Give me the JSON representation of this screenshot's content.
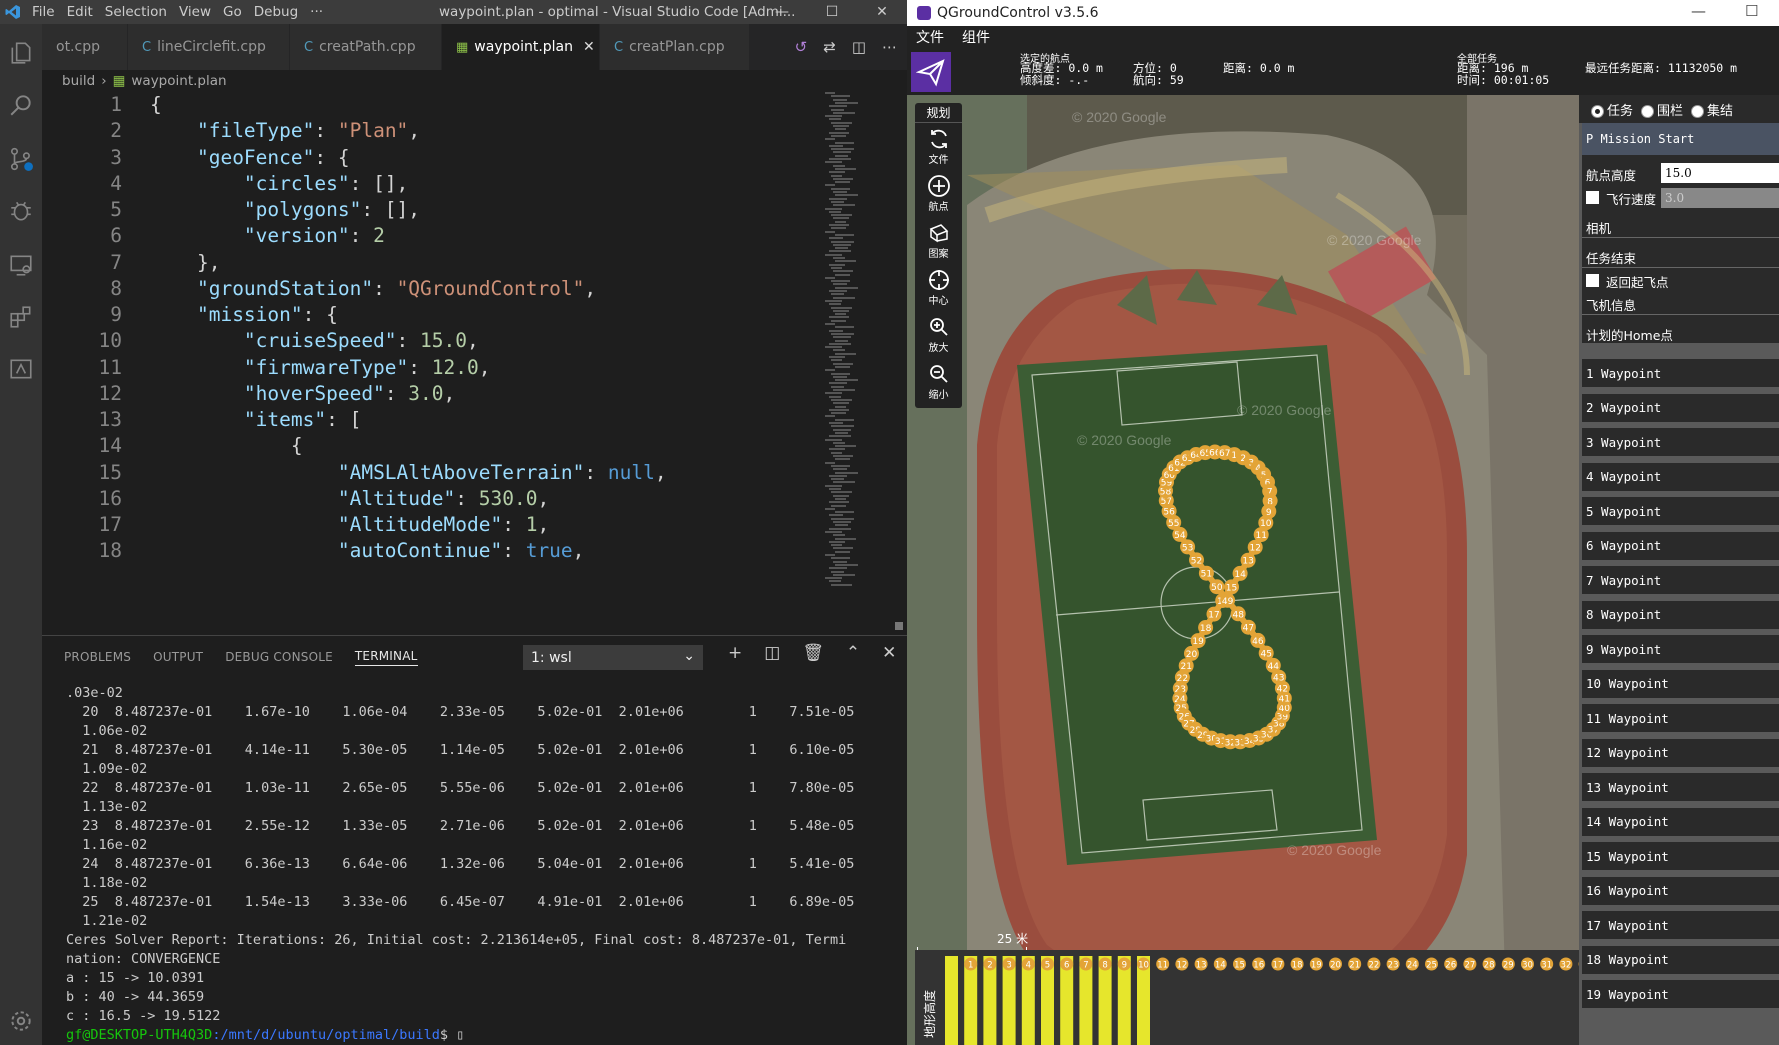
{
  "vscode": {
    "menu": [
      "File",
      "Edit",
      "Selection",
      "View",
      "Go",
      "Debug",
      "···"
    ],
    "window_title": "waypoint.plan - optimal - Visual Studio Code [Admi...",
    "tabs": [
      {
        "label": "ot.cpp",
        "icon": "C",
        "active": false
      },
      {
        "label": "lineCirclefit.cpp",
        "icon": "C",
        "active": false
      },
      {
        "label": "creatPath.cpp",
        "icon": "C",
        "active": false
      },
      {
        "label": "waypoint.plan",
        "icon": "file-icon",
        "active": true
      },
      {
        "label": "creatPlan.cpp",
        "icon": "C",
        "active": false
      }
    ],
    "breadcrumb": [
      "build",
      "waypoint.plan"
    ],
    "code_lines": [
      {
        "n": "1",
        "text": "{"
      },
      {
        "n": "2",
        "text": "    \"fileType\": \"Plan\","
      },
      {
        "n": "3",
        "text": "    \"geoFence\": {"
      },
      {
        "n": "4",
        "text": "        \"circles\": [],"
      },
      {
        "n": "5",
        "text": "        \"polygons\": [],"
      },
      {
        "n": "6",
        "text": "        \"version\": 2"
      },
      {
        "n": "7",
        "text": "    },"
      },
      {
        "n": "8",
        "text": "    \"groundStation\": \"QGroundControl\","
      },
      {
        "n": "9",
        "text": "    \"mission\": {"
      },
      {
        "n": "10",
        "text": "        \"cruiseSpeed\": 15.0,"
      },
      {
        "n": "11",
        "text": "        \"firmwareType\": 12.0,"
      },
      {
        "n": "12",
        "text": "        \"hoverSpeed\": 3.0,"
      },
      {
        "n": "13",
        "text": "        \"items\": ["
      },
      {
        "n": "14",
        "text": "            {"
      },
      {
        "n": "15",
        "text": "                \"AMSLAltAboveTerrain\": null,"
      },
      {
        "n": "16",
        "text": "                \"Altitude\": 530.0,"
      },
      {
        "n": "17",
        "text": "                \"AltitudeMode\": 1,"
      },
      {
        "n": "18",
        "text": "                \"autoContinue\": true,"
      }
    ],
    "panel_tabs": [
      "PROBLEMS",
      "OUTPUT",
      "DEBUG CONSOLE",
      "TERMINAL"
    ],
    "terminal_select": "1: wsl",
    "terminal_lines": [
      ".03e-02",
      "  20  8.487237e-01    1.67e-10    1.06e-04    2.33e-05    5.02e-01  2.01e+06        1    7.51e-05",
      "  1.06e-02",
      "  21  8.487237e-01    4.14e-11    5.30e-05    1.14e-05    5.02e-01  2.01e+06        1    6.10e-05",
      "  1.09e-02",
      "  22  8.487237e-01    1.03e-11    2.65e-05    5.55e-06    5.02e-01  2.01e+06        1    7.80e-05",
      "  1.13e-02",
      "  23  8.487237e-01    2.55e-12    1.33e-05    2.71e-06    5.02e-01  2.01e+06        1    5.48e-05",
      "  1.16e-02",
      "  24  8.487237e-01    6.36e-13    6.64e-06    1.32e-06    5.04e-01  2.01e+06        1    5.41e-05",
      "  1.18e-02",
      "  25  8.487237e-01    1.54e-13    3.33e-06    6.45e-07    4.91e-01  2.01e+06        1    6.89e-05",
      "  1.21e-02",
      "Ceres Solver Report: Iterations: 26, Initial cost: 2.213614e+05, Final cost: 8.487237e-01, Termi",
      "nation: CONVERGENCE",
      "a : 15 -> 10.0391",
      "b : 40 -> 44.3659",
      "c : 16.5 -> 19.5122"
    ],
    "prompt_user": "gf@DESKTOP-UTH4Q3D",
    "prompt_path": ":/mnt/d/ubuntu/optimal/build",
    "prompt_end": "$ "
  },
  "qgc": {
    "title": "QGroundControl v3.5.6",
    "menu": [
      "文件",
      "组件"
    ],
    "toolbar": {
      "selected_wp_label": "选定的航点",
      "alt_diff": "高度差:  0.0 m",
      "gradient": "倾斜度:  -.-",
      "azimuth": "方位:  0",
      "heading": "航向:  59",
      "distance": "距离:  0.0 m",
      "total_label": "全部任务",
      "total_distance": "距离:  196 m",
      "total_time": "时间:  00:01:05",
      "max_dist": "最远任务距离:  11132050 m"
    },
    "tools_header": "规划",
    "tools": [
      {
        "label": "文件",
        "icon": "sync-icon"
      },
      {
        "label": "航点",
        "icon": "plus-circle-icon"
      },
      {
        "label": "图案",
        "icon": "pattern-icon"
      },
      {
        "label": "中心",
        "icon": "crosshair-icon"
      },
      {
        "label": "放大",
        "icon": "zoom-in-icon"
      },
      {
        "label": "缩小",
        "icon": "zoom-out-icon"
      }
    ],
    "watermark": "© 2020 Google",
    "scale_label": "25 米",
    "alt_label": "地形高度",
    "mode_tabs": [
      "任务",
      "围栏",
      "集结"
    ],
    "mission_start": "P   Mission Start",
    "altitude_label": "航点高度",
    "altitude_value": "15.0",
    "speed_label": "飞行速度",
    "speed_value": "3.0",
    "camera_label": "相机",
    "mission_end_label": "任务结束",
    "rtl_label": "返回起飞点",
    "vehicle_info_label": "飞机信息",
    "home_label": "计划的Home点",
    "waypoints": [
      "1  Waypoint",
      "2  Waypoint",
      "3  Waypoint",
      "4  Waypoint",
      "5  Waypoint",
      "6  Waypoint",
      "7  Waypoint",
      "8  Waypoint",
      "9  Waypoint",
      "10  Waypoint",
      "11  Waypoint",
      "12  Waypoint",
      "13  Waypoint",
      "14  Waypoint",
      "15  Waypoint",
      "16  Waypoint",
      "17  Waypoint",
      "18  Waypoint",
      "19  Waypoint"
    ],
    "path_point_count": 67,
    "marker_color": "#e3a437",
    "alt_bar_count": 34
  }
}
